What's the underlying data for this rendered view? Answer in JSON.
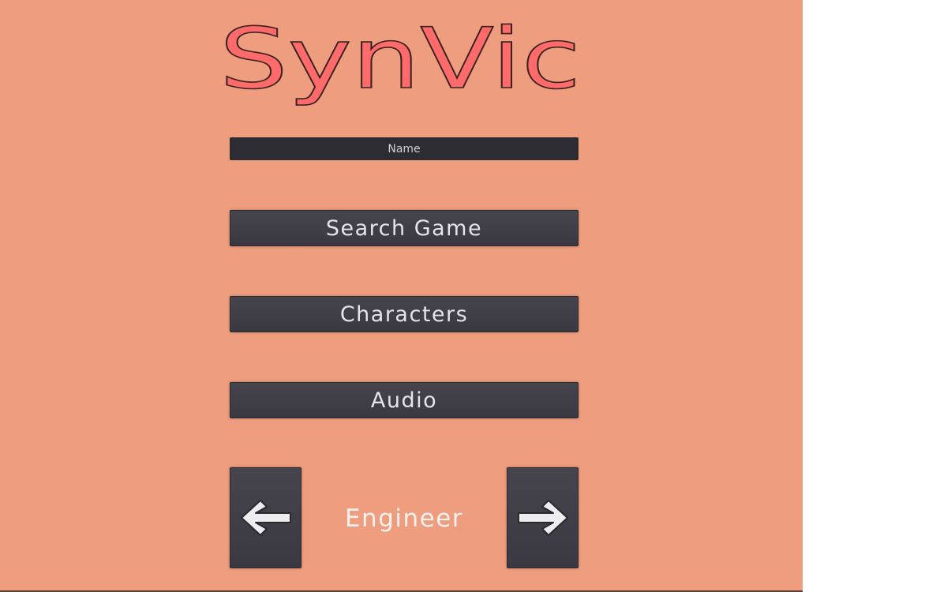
{
  "game": {
    "title": "SynVic"
  },
  "menu": {
    "name_placeholder": "Name",
    "name_value": "",
    "search_game_label": "Search Game",
    "characters_label": "Characters",
    "audio_label": "Audio"
  },
  "class_selector": {
    "selected_class": "Engineer",
    "prev_icon": "arrow-left-icon",
    "next_icon": "arrow-right-icon"
  },
  "colors": {
    "background": "#ee9d7e",
    "title_fill": "#ff6b6b",
    "button_bg": "#3f3e46",
    "field_bg": "#2d2c33",
    "text_light": "#e4e4ea"
  }
}
